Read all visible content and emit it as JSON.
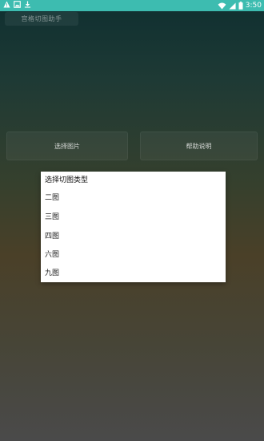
{
  "status_bar": {
    "time": "3:50",
    "icons": [
      "warning-icon",
      "image-icon",
      "download-icon",
      "wifi-icon",
      "signal-icon",
      "battery-icon"
    ]
  },
  "app": {
    "title": "宫格切图助手"
  },
  "buttons": {
    "select_image": "选择图片",
    "help": "帮助说明"
  },
  "dialog": {
    "title": "选择切图类型",
    "options": [
      "二图",
      "三图",
      "四图",
      "六图",
      "九图"
    ]
  },
  "colors": {
    "status_bar": "#3dbcb0",
    "dialog_bg": "#ffffff"
  }
}
